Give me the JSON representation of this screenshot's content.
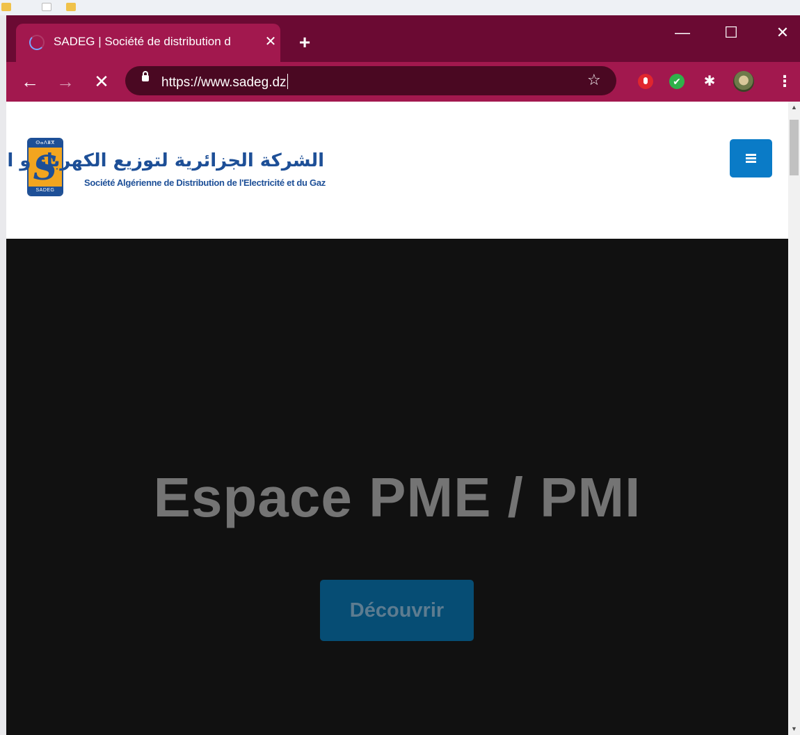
{
  "browser": {
    "tab_title": "SADEG | Société de distribution d",
    "tab_close": "✕",
    "new_tab": "+",
    "window_controls": {
      "minimize": "—",
      "maximize": "☐",
      "close": "✕"
    },
    "nav": {
      "back": "←",
      "forward": "→",
      "stop": "✕"
    },
    "url": "https://www.sadeg.dz",
    "bookmark_star": "☆",
    "extensions": [
      "adblock-icon",
      "check-icon",
      "puzzle-icon",
      "profile-avatar"
    ],
    "menu": "⋮"
  },
  "site": {
    "logo_band_top": "ⵙⴰⴷⴻⴳ",
    "logo_mark": "S",
    "logo_band_bottom": "SADEG",
    "brand_ar": "الشركة الجزائرية لتوزيع الكهرباء و الغاز",
    "brand_fr": "Société Algérienne de Distribution de l'Electricité et du Gaz"
  },
  "hero": {
    "title": "Espace PME / PMI",
    "button": "Découvrir"
  },
  "colors": {
    "chrome_frame": "#6b0a33",
    "chrome_toolbar": "#a2184e",
    "brand_blue": "#1d4f97",
    "menu_button": "#0a7bc7",
    "hero_bg": "#111111"
  }
}
